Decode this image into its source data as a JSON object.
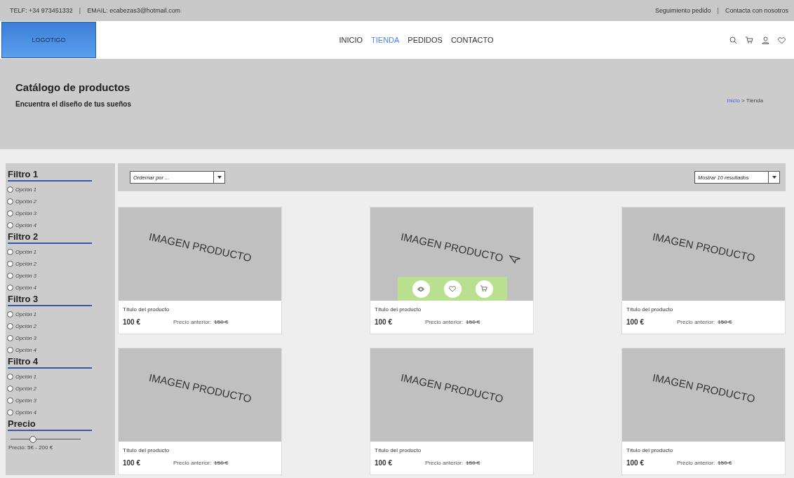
{
  "top_bar": {
    "phone": "TELF: +34 973451332",
    "email": "EMAIL: ecabezas3@hotmail.com",
    "links": [
      "Seguimiento pedido",
      "Contacta con nosotros"
    ],
    "separators": [
      "|",
      "|"
    ]
  },
  "header": {
    "logo": "LOGOTIGO",
    "nav": [
      {
        "label": "INICIO",
        "selected": false
      },
      {
        "label": "TIENDA",
        "selected": true
      },
      {
        "label": "PEDIDOS",
        "selected": false
      },
      {
        "label": "CONTACTO",
        "selected": false
      }
    ]
  },
  "hero": {
    "title": "Catálogo de productos",
    "subtitle": "Encuentra el diseño de tus sueños",
    "breadcrumb": {
      "link": "Inicio",
      "separator": ">",
      "current": "Tienda"
    }
  },
  "filters": [
    {
      "title": "Filtro 1",
      "options": [
        {
          "label": "Opción 1",
          "selected": false
        },
        {
          "label": "Opción 2",
          "selected": false
        },
        {
          "label": "Opción 3",
          "selected": false
        },
        {
          "label": "Opción 4",
          "selected": false
        }
      ]
    },
    {
      "title": "Filtro 2",
      "options": [
        {
          "label": "Opción 1",
          "selected": false
        },
        {
          "label": "Opción 2",
          "selected": false
        },
        {
          "label": "Opción 3",
          "selected": false
        },
        {
          "label": "Opción 4",
          "selected": false
        }
      ]
    },
    {
      "title": "Filtro 3",
      "options": [
        {
          "label": "Opción 1",
          "selected": false
        },
        {
          "label": "Opción 2",
          "selected": false
        },
        {
          "label": "Opción 3",
          "selected": false
        },
        {
          "label": "Opción 4",
          "selected": false
        }
      ]
    },
    {
      "title": "Filtro 4",
      "options": [
        {
          "label": "Opción 1",
          "selected": false
        },
        {
          "label": "Opción 2",
          "selected": false
        },
        {
          "label": "Opción 3",
          "selected": false
        },
        {
          "label": "Opción 4",
          "selected": false
        }
      ]
    }
  ],
  "price_filter": {
    "title": "Precio",
    "level": 0.32,
    "reading": "Precio: 5€ - 200 €"
  },
  "toolbar": {
    "sort": {
      "placeholder": "Ordernar por ..."
    },
    "page_size": {
      "value": "Mostrar 10 resultados"
    }
  },
  "products": [
    {
      "image_label": "IMAGEN PRODUCTO",
      "title": "Título del producto",
      "price": "100 €",
      "old_price_label": "Precio anterior:",
      "old_price": "150 €",
      "hovered": false
    },
    {
      "image_label": "IMAGEN PRODUCTO",
      "title": "Título del producto",
      "price": "100 €",
      "old_price_label": "Precio anterior:",
      "old_price": "150 €",
      "hovered": true
    },
    {
      "image_label": "IMAGEN PRODUCTO",
      "title": "Título del producto",
      "price": "100 €",
      "old_price_label": "Precio anterior:",
      "old_price": "150 €",
      "hovered": false
    },
    {
      "image_label": "IMAGEN PRODUCTO",
      "title": "Título del producto",
      "price": "100 €",
      "old_price_label": "Precio anterior:",
      "old_price": "150 €",
      "hovered": false
    },
    {
      "image_label": "IMAGEN PRODUCTO",
      "title": "Título del producto",
      "price": "100 €",
      "old_price_label": "Precio anterior:",
      "old_price": "150 €",
      "hovered": false
    },
    {
      "image_label": "IMAGEN PRODUCTO",
      "title": "Título del producto",
      "price": "100 €",
      "old_price_label": "Precio anterior:",
      "old_price": "150 €",
      "hovered": false
    }
  ]
}
